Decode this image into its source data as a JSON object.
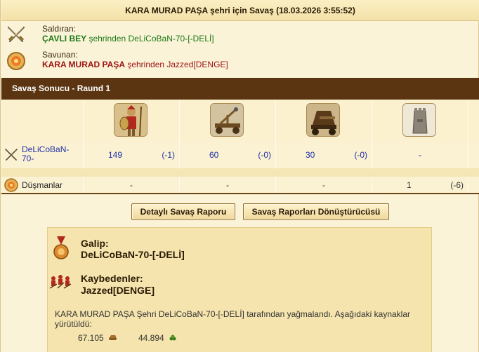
{
  "title": "KARA MURAD PAŞA şehri için Savaş (18.03.2026 3:55:52)",
  "attacker": {
    "label": "Saldıran:",
    "player": "ÇAVLI BEY",
    "rest": " şehrinden DeLiCoBaN-70-[-DELİ]",
    "icon": "crossed-swords-icon"
  },
  "defender": {
    "label": "Savunan:",
    "player": "KARA MURAD PAŞA",
    "rest": " şehrinden Jazzed[DENGE]",
    "icon": "shield-target-icon"
  },
  "result_header": "Savaş Sonucu - Raund 1",
  "units": [
    {
      "name": "hoplite-icon"
    },
    {
      "name": "catapult-icon"
    },
    {
      "name": "siege-ram-icon"
    },
    {
      "name": "wall-tower-icon"
    }
  ],
  "rows": {
    "ours": {
      "label": "DeLiCoBaN-70-",
      "cells": [
        {
          "count": "149",
          "loss": "(-1)"
        },
        {
          "count": "60",
          "loss": "(-0)"
        },
        {
          "count": "30",
          "loss": "(-0)"
        },
        {
          "dash": "-"
        }
      ]
    },
    "enemies": {
      "label": "Düşmanlar",
      "cells": [
        {
          "dash": "-"
        },
        {
          "dash": "-"
        },
        {
          "dash": "-"
        },
        {
          "count": "1",
          "loss": "(-6)"
        }
      ]
    }
  },
  "buttons": {
    "detailed": "Detaylı Savaş Raporu",
    "converter": "Savaş Raporları Dönüştürücüsü"
  },
  "summary": {
    "winner_head": "Galip:",
    "winner": "DeLiCoBaN-70-[-DELİ]",
    "losers_head": "Kaybedenler:",
    "losers": "Jazzed[DENGE]",
    "plunder_text": "KARA MURAD PAŞA Şehri DeLiCoBaN-70-[-DELİ] tarafından yağmalandı. Aşağıdaki kaynaklar yürütüldü:",
    "resources": [
      {
        "amount": "67.105",
        "icon": "wood-icon"
      },
      {
        "amount": "44.894",
        "icon": "wine-icon"
      }
    ]
  },
  "colors": {
    "header_brown": "#5b3512",
    "attacker_green": "#1c7a17",
    "defender_red": "#9c1212",
    "link_blue": "#1f2fa8"
  }
}
